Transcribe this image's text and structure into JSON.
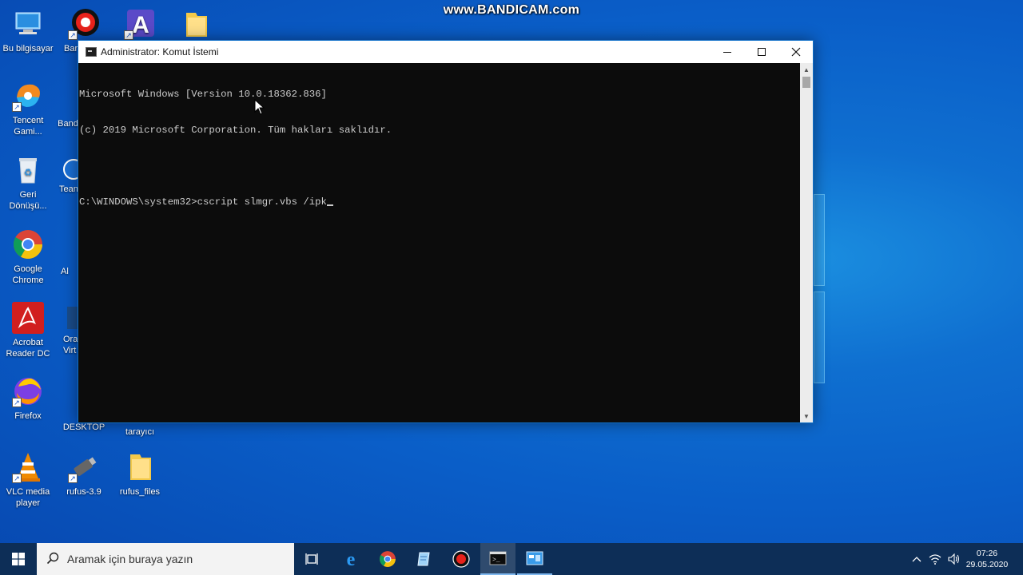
{
  "watermark": "www.BANDICAM.com",
  "desktop_icons": [
    {
      "label": "Bu bilgisayar"
    },
    {
      "label": "Bar"
    },
    {
      "label": "Tencent\nGami..."
    },
    {
      "label": "Band"
    },
    {
      "label": "Geri\nDönüşü..."
    },
    {
      "label": "Tean"
    },
    {
      "label": "Google\nChrome"
    },
    {
      "label": "Al"
    },
    {
      "label": "Acrobat\nReader DC"
    },
    {
      "label": "Ora\nVirt"
    },
    {
      "label": "Firefox"
    },
    {
      "label": "Pr\nDESKTOP"
    },
    {
      "label": "tarayıcı"
    },
    {
      "label": "VLC media\nplayer"
    },
    {
      "label": "rufus-3.9"
    },
    {
      "label": "rufus_files"
    }
  ],
  "cmd_window": {
    "title": "Administrator: Komut İstemi",
    "minimize": "—",
    "maximize": "☐",
    "close": "✕",
    "lines": [
      "Microsoft Windows [Version 10.0.18362.836]",
      "(c) 2019 Microsoft Corporation. Tüm hakları saklıdır.",
      "",
      "C:\\WINDOWS\\system32>cscript slmgr.vbs /ipk"
    ]
  },
  "taskbar": {
    "search_placeholder": "Aramak için buraya yazın",
    "apps": [
      "task-view",
      "edge",
      "chrome",
      "notepad",
      "bandicam",
      "cmd",
      "desktop-app"
    ],
    "time": "07:26",
    "date": "29.05.2020"
  },
  "colors": {
    "console_bg": "#0c0c0c",
    "console_text": "#cccccc",
    "taskbar_bg": "#0d2e57",
    "accent": "#1070c8"
  }
}
